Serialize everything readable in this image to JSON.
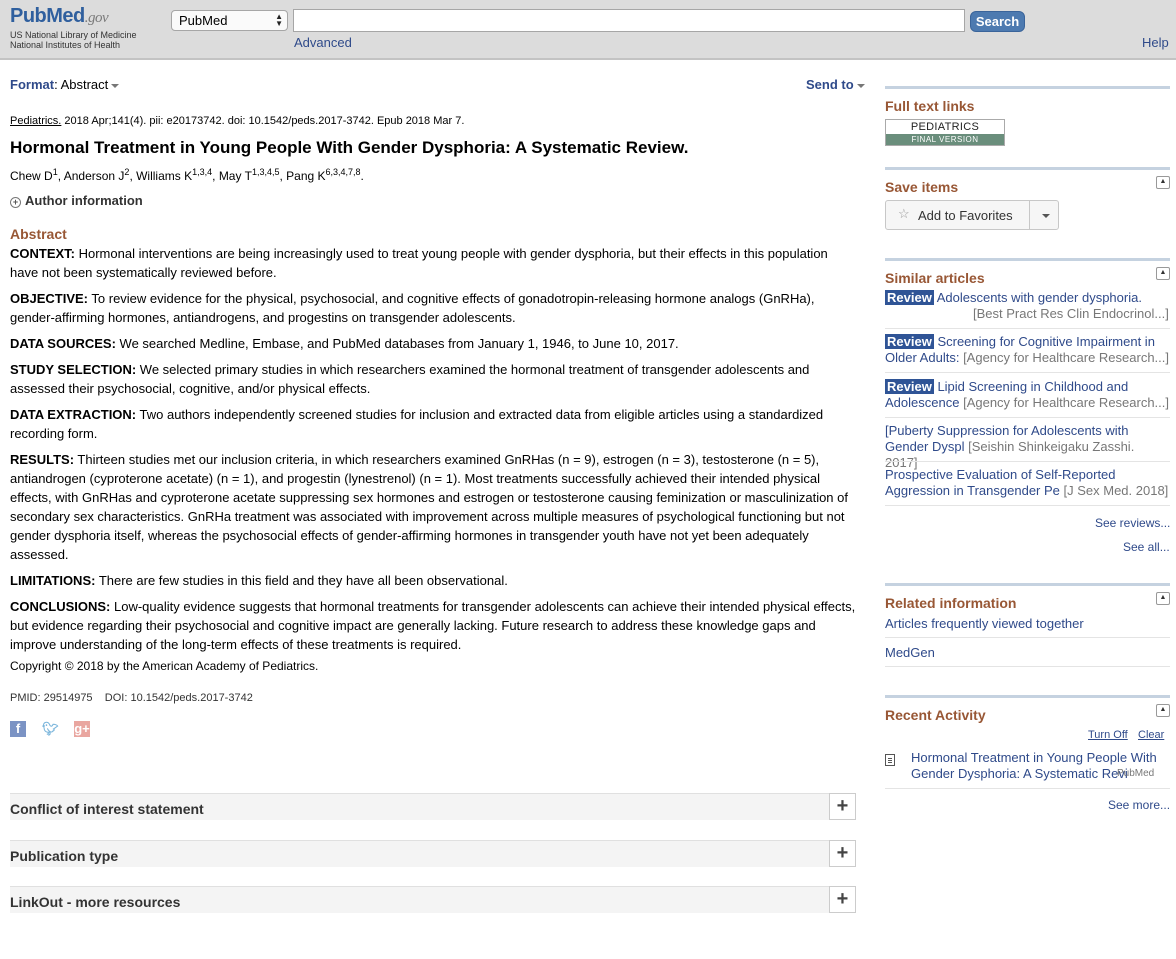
{
  "header": {
    "logo_word": "PubMed",
    "logo_gov": ".gov",
    "org_line1": "US National Library of Medicine",
    "org_line2": "National Institutes of Health",
    "db_selected": "PubMed",
    "search_value": "",
    "search_button": "Search",
    "advanced": "Advanced",
    "help": "Help"
  },
  "toolbar": {
    "format_label": "Format",
    "format_value": ": Abstract",
    "send_to": "Send to"
  },
  "article": {
    "journal": "Pediatrics.",
    "citation_rest": " 2018 Apr;141(4). pii: e20173742. doi: 10.1542/peds.2017-3742. Epub 2018 Mar 7.",
    "title": "Hormonal Treatment in Young People With Gender Dysphoria: A Systematic Review.",
    "authors": [
      {
        "name": "Chew D",
        "aff": "1"
      },
      {
        "name": "Anderson J",
        "aff": "2"
      },
      {
        "name": "Williams K",
        "aff": "1,3,4"
      },
      {
        "name": "May T",
        "aff": "1,3,4,5"
      },
      {
        "name": "Pang K",
        "aff": "6,3,4,7,8"
      }
    ],
    "author_info": "Author information",
    "abstract_heading": "Abstract",
    "abstract": [
      {
        "label": "CONTEXT:",
        "text": " Hormonal interventions are being increasingly used to treat young people with gender dysphoria, but their effects in this population have not been systematically reviewed before."
      },
      {
        "label": "OBJECTIVE:",
        "text": " To review evidence for the physical, psychosocial, and cognitive effects of gonadotropin-releasing hormone analogs (GnRHa), gender-affirming hormones, antiandrogens, and progestins on transgender adolescents."
      },
      {
        "label": "DATA SOURCES:",
        "text": " We searched Medline, Embase, and PubMed databases from January 1, 1946, to June 10, 2017."
      },
      {
        "label": "STUDY SELECTION:",
        "text": " We selected primary studies in which researchers examined the hormonal treatment of transgender adolescents and assessed their psychosocial, cognitive, and/or physical effects."
      },
      {
        "label": "DATA EXTRACTION:",
        "text": " Two authors independently screened studies for inclusion and extracted data from eligible articles using a standardized recording form."
      },
      {
        "label": "RESULTS:",
        "text": " Thirteen studies met our inclusion criteria, in which researchers examined GnRHas (n = 9), estrogen (n = 3), testosterone (n = 5), antiandrogen (cyproterone acetate) (n = 1), and progestin (lynestrenol) (n = 1). Most treatments successfully achieved their intended physical effects, with GnRHas and cyproterone acetate suppressing sex hormones and estrogen or testosterone causing feminization or masculinization of secondary sex characteristics. GnRHa treatment was associated with improvement across multiple measures of psychological functioning but not gender dysphoria itself, whereas the psychosocial effects of gender-affirming hormones in transgender youth have not yet been adequately assessed."
      },
      {
        "label": "LIMITATIONS:",
        "text": " There are few studies in this field and they have all been observational."
      },
      {
        "label": "CONCLUSIONS:",
        "text": " Low-quality evidence suggests that hormonal treatments for transgender adolescents can achieve their intended physical effects, but evidence regarding their psychosocial and cognitive impact are generally lacking. Future research to address these knowledge gaps and improve understanding of the long-term effects of these treatments is required."
      }
    ],
    "copyright": "Copyright © 2018 by the American Academy of Pediatrics.",
    "pmid": "PMID: 29514975",
    "doi_label": "DOI:",
    "doi": "10.1542/peds.2017-3742"
  },
  "social": {
    "facebook": "f",
    "twitter": "t",
    "googleplus": "g+"
  },
  "sections": [
    "Conflict of interest statement",
    "Publication type",
    "LinkOut - more resources"
  ],
  "sidebar": {
    "full_text_heading": "Full text links",
    "full_text_logo_top": "PEDIATRICS",
    "full_text_logo_bottom": "FINAL VERSION",
    "save_heading": "Save items",
    "add_favorites": "Add to Favorites",
    "similar_heading": "Similar articles",
    "similar": [
      {
        "tag": "Review",
        "title": "Adolescents with gender dysphoria.",
        "source": "[Best Pract Res Clin Endocrinol...]"
      },
      {
        "tag": "Review",
        "title": "Screening for Cognitive Impairment in Older Adults:",
        "source": "[Agency for Healthcare Research...]"
      },
      {
        "tag": "Review",
        "title": "Lipid Screening in Childhood and Adolescence",
        "source": "[Agency for Healthcare Research...]"
      },
      {
        "tag": "",
        "title": "[Puberty Suppression for Adolescents with Gender Dyspl",
        "source": "[Seishin Shinkeigaku Zasshi. 2017]"
      },
      {
        "tag": "",
        "title": "Prospective Evaluation of Self-Reported Aggression in Transgender Pe",
        "source": "[J Sex Med. 2018]"
      }
    ],
    "see_reviews": "See reviews...",
    "see_all": "See all...",
    "related_heading": "Related information",
    "related": [
      "Articles frequently viewed together",
      "MedGen"
    ],
    "recent_heading": "Recent Activity",
    "turn_off": "Turn Off",
    "clear": "Clear",
    "recent_item": "Hormonal Treatment in Young People With Gender Dysphoria: A Systematic Revi",
    "recent_source": "PubMed",
    "see_more": "See more..."
  }
}
